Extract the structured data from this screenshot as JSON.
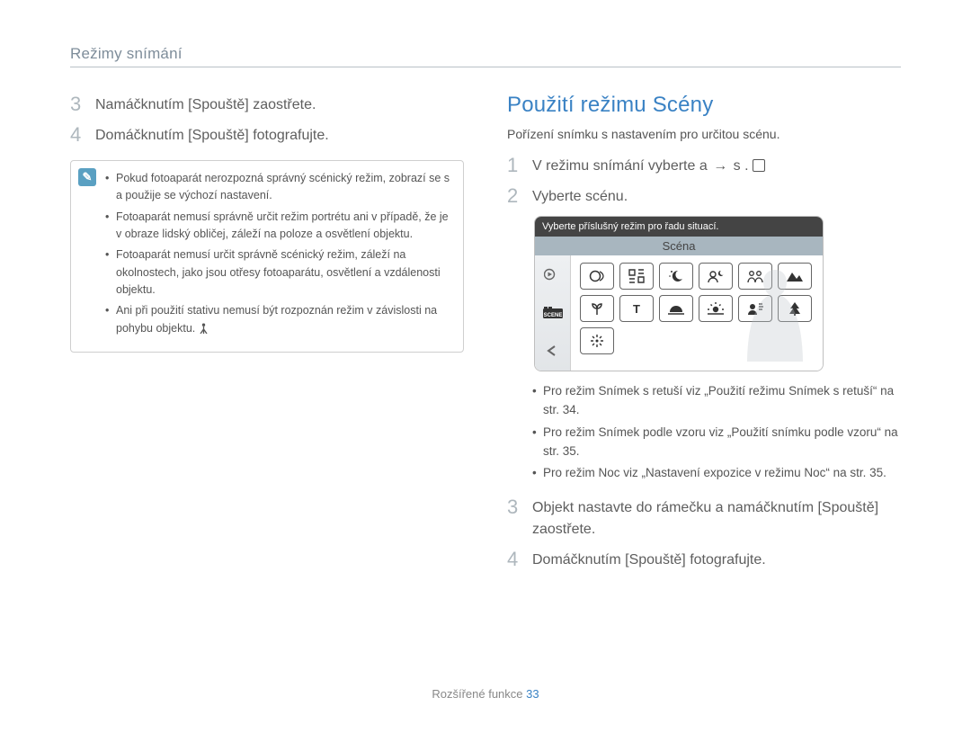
{
  "header": {
    "breadcrumb": "Režimy snímání"
  },
  "left": {
    "steps": [
      {
        "num": "3",
        "text": "Namáčknutím [Spouště] zaostřete."
      },
      {
        "num": "4",
        "text": "Domáčknutím [Spouště] fotografujte."
      }
    ],
    "note": {
      "items": [
        "Pokud fotoaparát nerozpozná správný scénický režim, zobrazí se s a použije se výchozí nastavení.",
        "Fotoaparát nemusí správně určit režim portrétu ani v případě, že je v obraze lidský obličej, záleží na poloze a osvětlení objektu.",
        "Fotoaparát nemusí určit správně scénický režim, záleží na okolnostech, jako jsou otřesy fotoaparátu, osvětlení a vzdálenosti objektu.",
        "Ani při použití stativu nemusí být rozpoznán režim  v závislosti na pohybu objektu."
      ]
    }
  },
  "right": {
    "title": "Použití režimu Scény",
    "subtitle": "Pořízení snímku s nastavením pro určitou scénu.",
    "steps12": [
      {
        "num": "1",
        "text_before": "V režimu snímání vyberte a",
        "text_after": "s ."
      },
      {
        "num": "2",
        "text": "Vyberte scénu."
      }
    ],
    "camera": {
      "tip": "Vyberte příslušný režim pro řadu situací.",
      "label": "Scéna",
      "side": [
        "▶",
        "◀"
      ],
      "icons_row1": [
        "person-swirl",
        "frame",
        "night",
        "portrait-night",
        "children",
        "landscape"
      ],
      "icons_row2": [
        "macro",
        "text",
        "sunset",
        "dawn",
        "backlight",
        "tree"
      ],
      "icons_row3": [
        "fireworks"
      ]
    },
    "tips": [
      "Pro režim Snímek s retuší viz „Použití režimu Snímek s retuší“ na str. 34.",
      "Pro režim Snímek podle vzoru viz „Použití snímku podle vzoru“ na str. 35.",
      "Pro režim Noc viz „Nastavení expozice v režimu Noc“ na str. 35."
    ],
    "steps34": [
      {
        "num": "3",
        "text": "Objekt nastavte do rámečku a namáčknutím [Spouště] zaostřete."
      },
      {
        "num": "4",
        "text": "Domáčknutím [Spouště] fotografujte."
      }
    ]
  },
  "footer": {
    "label": "Rozšířené funkce",
    "page": "33"
  }
}
